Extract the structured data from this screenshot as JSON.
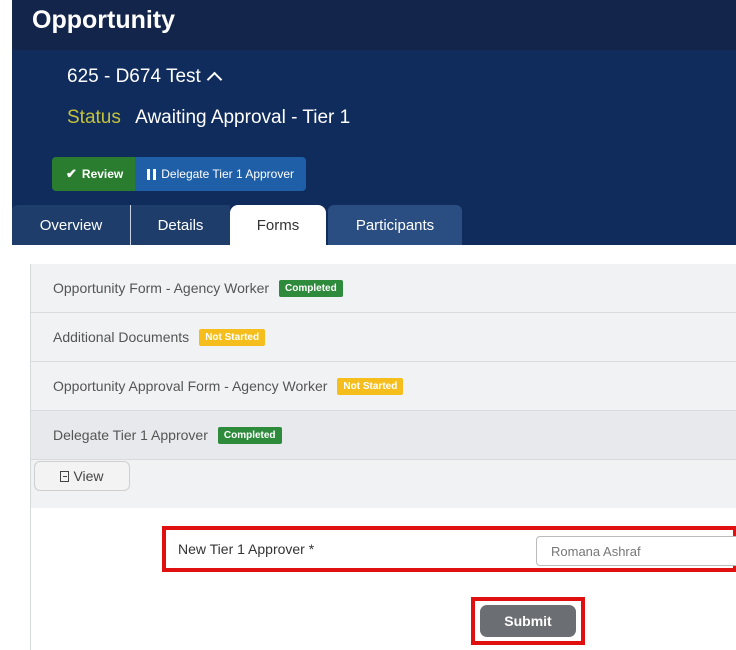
{
  "app": {
    "title": "Opportunity"
  },
  "record": {
    "title": "625 - D674 Test",
    "status_label": "Status",
    "status_value": "Awaiting Approval - Tier 1"
  },
  "actions": {
    "review": "Review",
    "delegate": "Delegate Tier 1 Approver"
  },
  "tabs": [
    {
      "label": "Overview"
    },
    {
      "label": "Details"
    },
    {
      "label": "Forms",
      "active": true
    },
    {
      "label": "Participants"
    }
  ],
  "forms": [
    {
      "name": "Opportunity Form - Agency Worker",
      "status": "Completed"
    },
    {
      "name": "Additional Documents",
      "status": "Not Started"
    },
    {
      "name": "Opportunity Approval Form - Agency Worker",
      "status": "Not Started"
    },
    {
      "name": "Delegate Tier 1 Approver",
      "status": "Completed"
    }
  ],
  "view_button": "View",
  "form": {
    "field_label": "New Tier 1 Approver *",
    "field_value": "Romana Ashraf",
    "submit_label": "Submit"
  },
  "colors": {
    "header": "#0f2c5c",
    "completed": "#2e8b3b",
    "not_started": "#f5be1c",
    "highlight": "#e01010"
  }
}
